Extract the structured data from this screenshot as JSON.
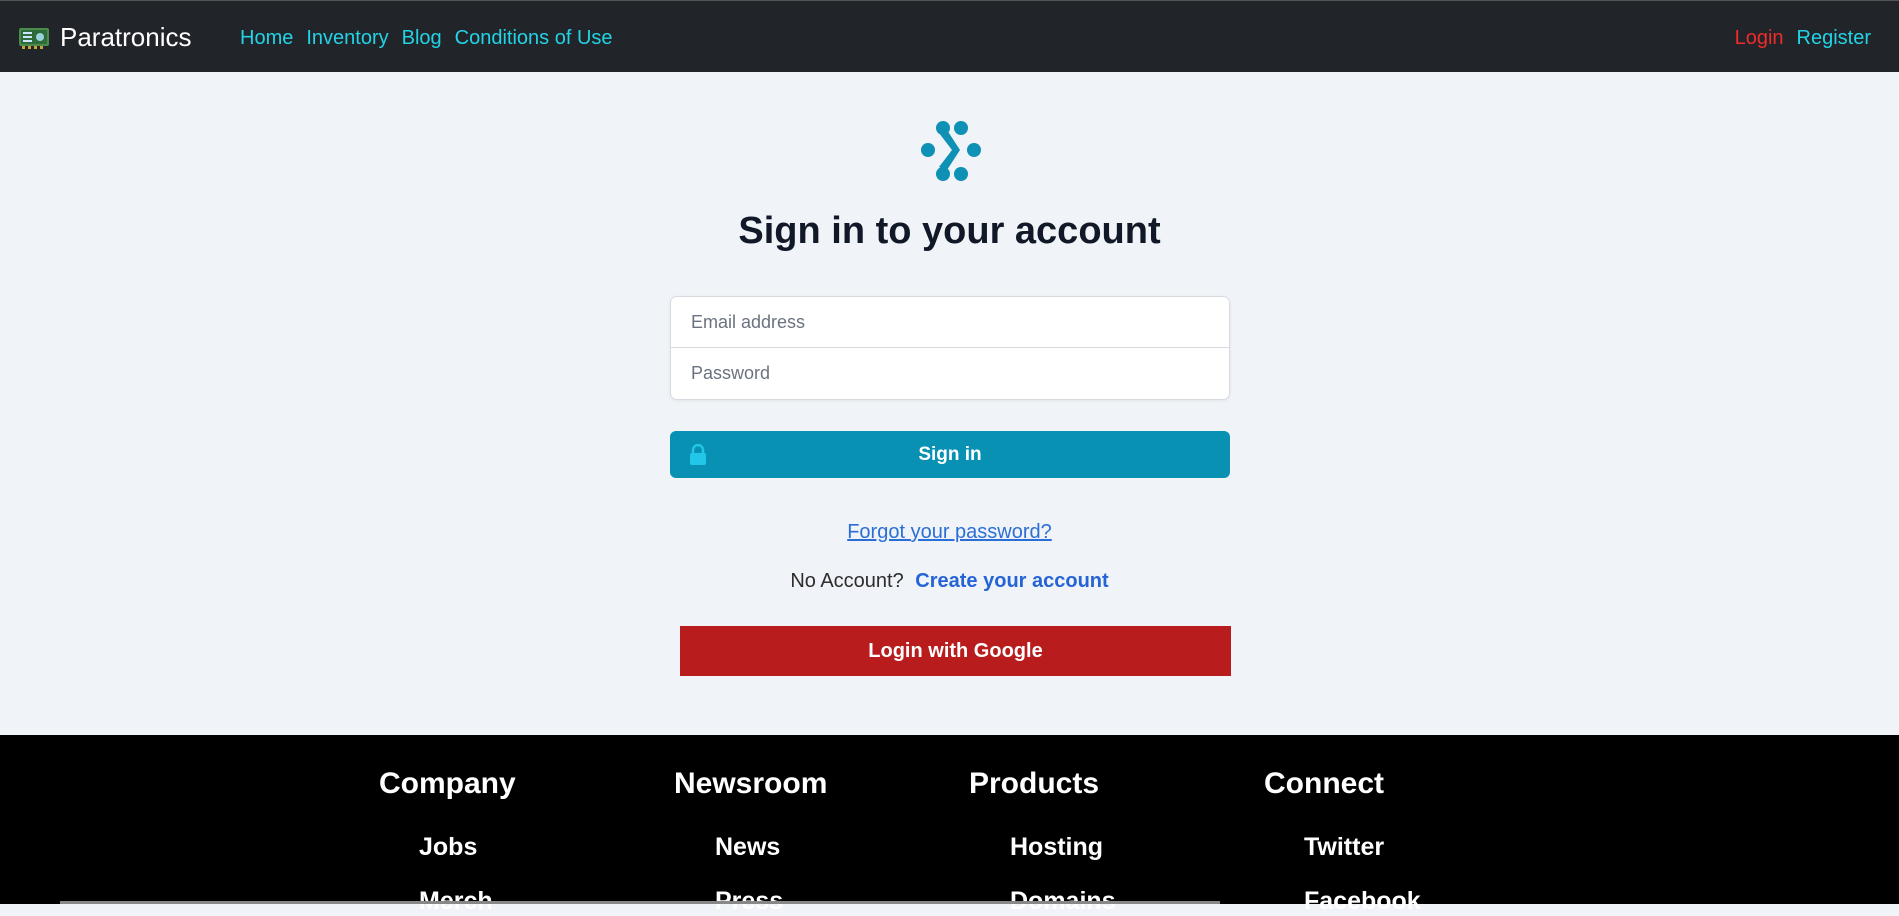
{
  "nav": {
    "brand": "Paratronics",
    "links": [
      "Home",
      "Inventory",
      "Blog",
      "Conditions of Use"
    ],
    "login": "Login",
    "register": "Register"
  },
  "main": {
    "title": "Sign in to your account",
    "email_placeholder": "Email address",
    "password_placeholder": "Password",
    "signin_label": "Sign in",
    "forgot_label": "Forgot your password?",
    "no_account_text": "No Account?",
    "create_account_label": "Create your account",
    "google_label": "Login with Google"
  },
  "footer": {
    "columns": [
      {
        "heading": "Company",
        "links": [
          "Jobs",
          "Merch"
        ]
      },
      {
        "heading": "Newsroom",
        "links": [
          "News",
          "Press"
        ]
      },
      {
        "heading": "Products",
        "links": [
          "Hosting",
          "Domains"
        ]
      },
      {
        "heading": "Connect",
        "links": [
          "Twitter",
          "Facebook"
        ]
      }
    ]
  },
  "colors": {
    "nav_bg": "#212529",
    "nav_link": "#22d3e6",
    "login_link": "#ef2b2b",
    "signin_button": "#0891b2",
    "google_button": "#b91c1c",
    "footer_bg": "#000000"
  },
  "icons": [
    "circuit-board-icon",
    "logo-icon",
    "lock-icon"
  ]
}
